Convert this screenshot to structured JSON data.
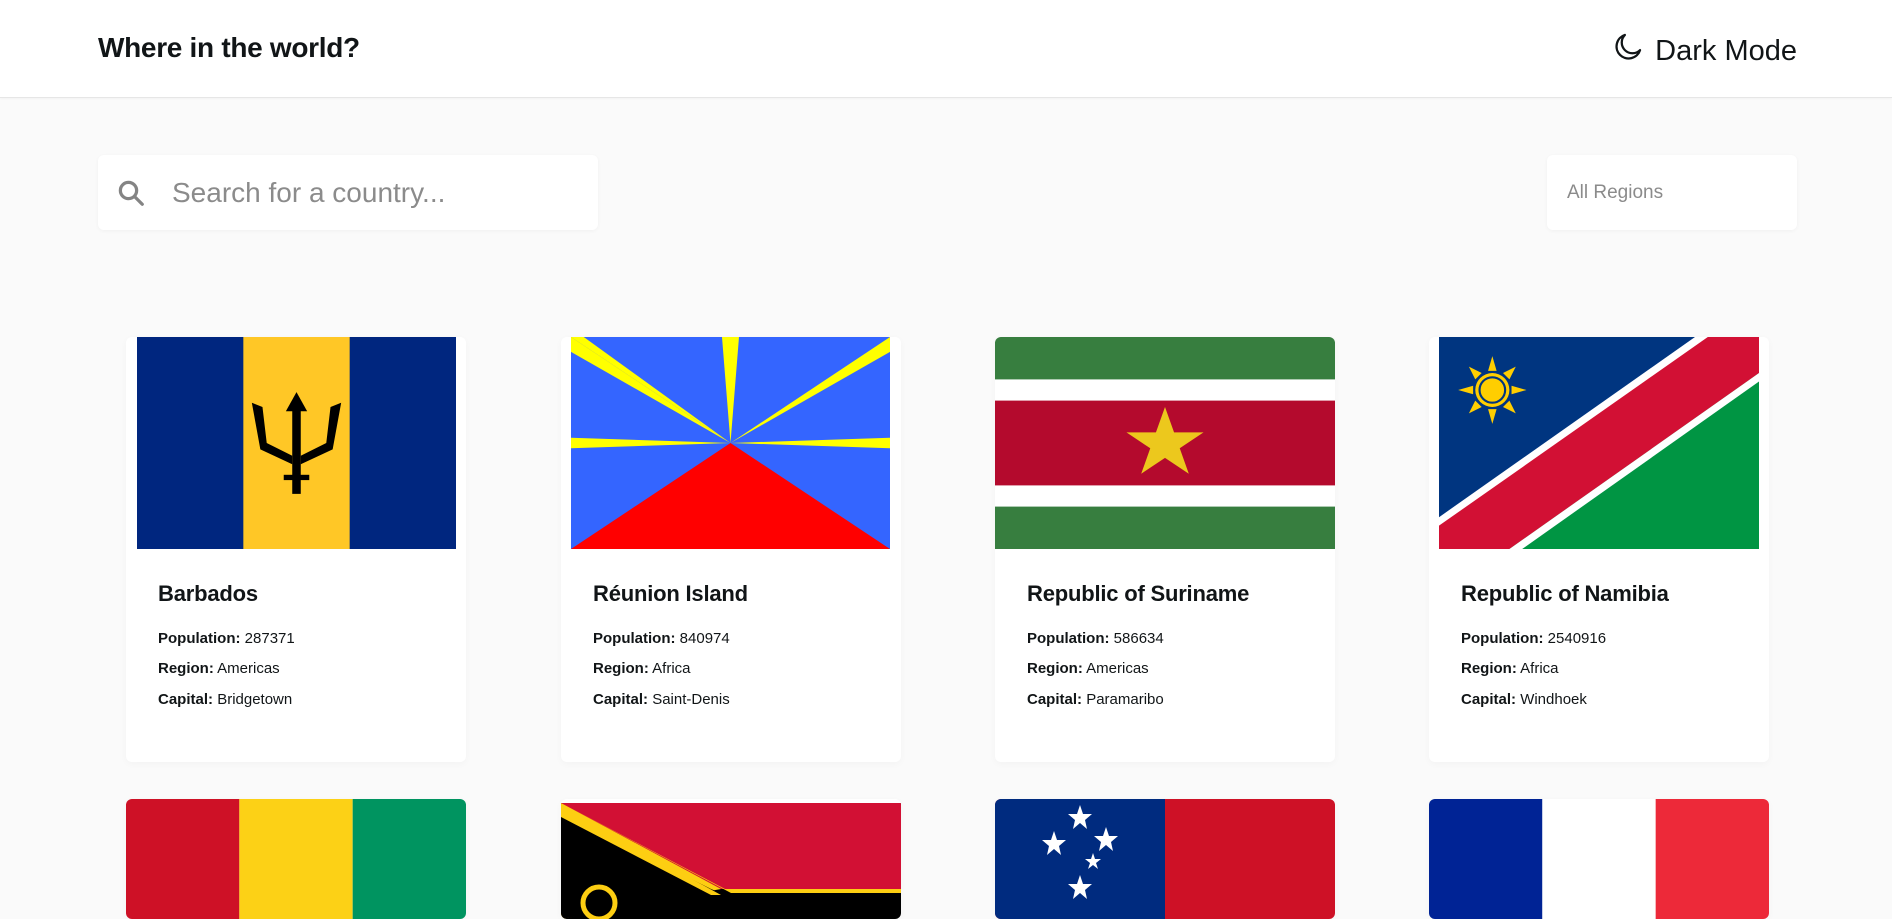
{
  "header": {
    "title": "Where in the world?",
    "mode_label": "Dark Mode"
  },
  "search": {
    "placeholder": "Search for a country..."
  },
  "filter": {
    "selected": "All Regions"
  },
  "labels": {
    "population": "Population:",
    "region": "Region:",
    "capital": "Capital:"
  },
  "countries": [
    {
      "name": "Barbados",
      "population": "287371",
      "region": "Americas",
      "capital": "Bridgetown",
      "flag_icon": "barbados-flag"
    },
    {
      "name": "Réunion Island",
      "population": "840974",
      "region": "Africa",
      "capital": "Saint-Denis",
      "flag_icon": "reunion-flag"
    },
    {
      "name": "Republic of Suriname",
      "population": "586634",
      "region": "Americas",
      "capital": "Paramaribo",
      "flag_icon": "suriname-flag"
    },
    {
      "name": "Republic of Namibia",
      "population": "2540916",
      "region": "Africa",
      "capital": "Windhoek",
      "flag_icon": "namibia-flag"
    },
    {
      "flag_icon": "guinea-flag"
    },
    {
      "flag_icon": "vanuatu-flag"
    },
    {
      "flag_icon": "samoa-flag"
    },
    {
      "flag_icon": "france-flag"
    }
  ],
  "colors": {
    "background": "#fafafa",
    "card": "#ffffff",
    "text": "#111517",
    "placeholder": "#8b8b8b"
  }
}
